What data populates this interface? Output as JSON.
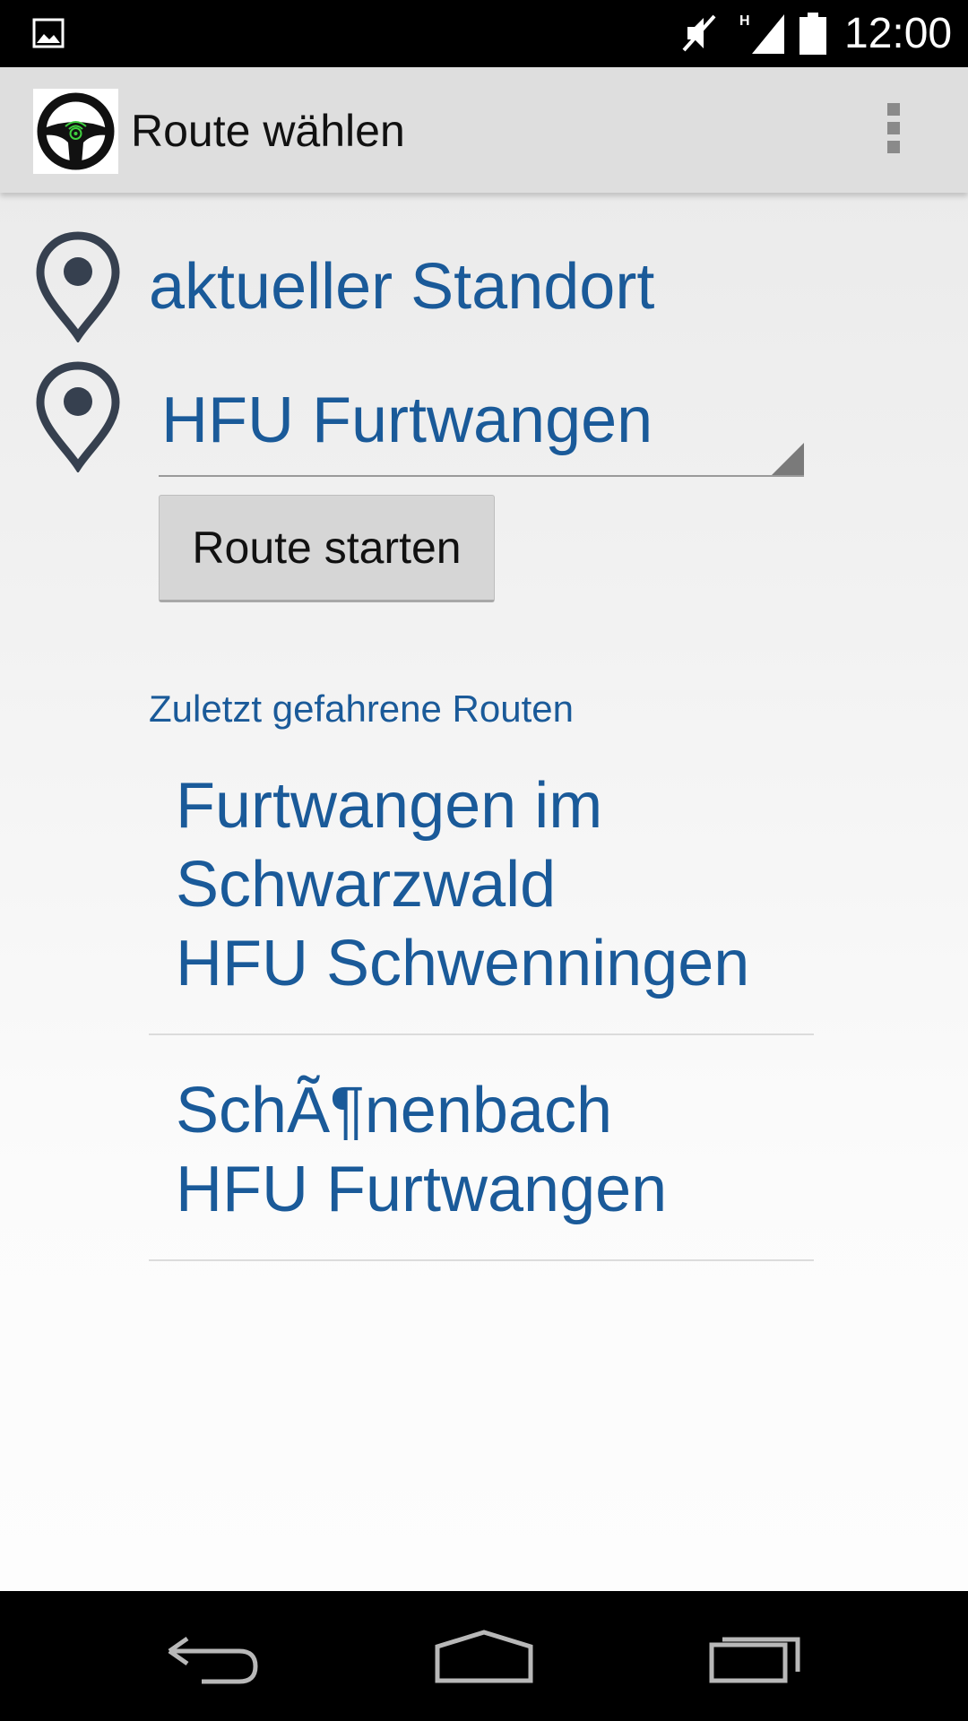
{
  "status_bar": {
    "time": "12:00",
    "network_type": "H",
    "icons": [
      "gallery-icon",
      "mute-icon",
      "signal-icon",
      "battery-icon"
    ]
  },
  "action_bar": {
    "title": "Route wählen",
    "app_icon": "steering-wheel-icon",
    "menu_icon": "overflow-menu-icon"
  },
  "route_form": {
    "origin": "aktueller Standort",
    "destination": "HFU Furtwangen",
    "start_button_label": "Route starten"
  },
  "recent_routes": {
    "header": "Zuletzt gefahrene Routen",
    "items": [
      {
        "from": "Furtwangen im Schwarzwald",
        "to": "HFU Schwenningen"
      },
      {
        "from": "SchÃ¶nenbach",
        "to": "HFU Furtwangen"
      }
    ]
  },
  "nav_bar": {
    "icons": [
      "back-icon",
      "home-icon",
      "recent-apps-icon"
    ]
  },
  "colors": {
    "accent": "#1a5a99",
    "action_bar": "#dedede",
    "pin": "#36404f",
    "wheel_signal": "#3fcf3f"
  }
}
